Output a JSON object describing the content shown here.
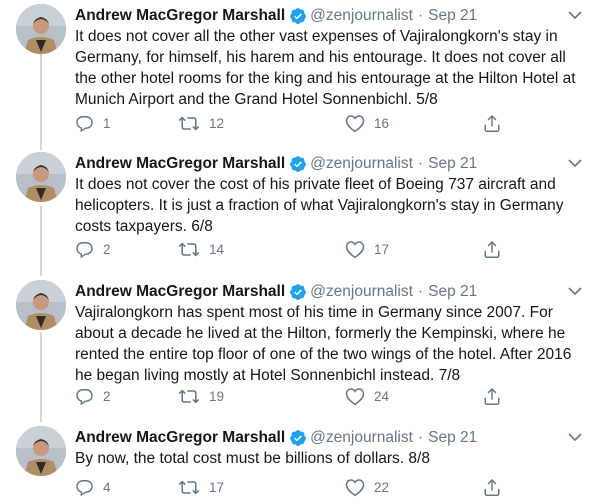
{
  "tweets": [
    {
      "name": "Andrew MacGregor Marshall",
      "handle": "@zenjournalist",
      "separator": "·",
      "date": "Sep 21",
      "lines": [
        "It does not cover all the other vast expenses of Vajiralongkorn's stay in",
        "Germany, for himself, his harem and his entourage. It does not cover all",
        "the other hotel rooms for the king and his entourage at the Hilton Hotel at",
        "Munich Airport and the Grand Hotel Sonnenbichl. 5/8"
      ],
      "replies": "1",
      "retweets": "12",
      "likes": "16"
    },
    {
      "name": "Andrew MacGregor Marshall",
      "handle": "@zenjournalist",
      "separator": "·",
      "date": "Sep 21",
      "lines": [
        "It does not cover the cost of his private fleet of Boeing 737 aircraft and",
        "helicopters. It is just a fraction of what Vajiralongkorn's stay in Germany",
        "costs taxpayers. 6/8"
      ],
      "replies": "2",
      "retweets": "14",
      "likes": "17"
    },
    {
      "name": "Andrew MacGregor Marshall",
      "handle": "@zenjournalist",
      "separator": "·",
      "date": "Sep 21",
      "lines": [
        "Vajiralongkorn has spent most of his time in Germany since 2007. For",
        "about a decade he lived at the Hilton, formerly the Kempinski, where he",
        "rented the entire top floor of one of the two wings of the hotel. After 2016",
        "he began living mostly at Hotel Sonnenbichl instead. 7/8"
      ],
      "replies": "2",
      "retweets": "19",
      "likes": "24"
    },
    {
      "name": "Andrew MacGregor Marshall",
      "handle": "@zenjournalist",
      "separator": "·",
      "date": "Sep 21",
      "lines": [
        "By now, the total cost must be billions of dollars. 8/8"
      ],
      "replies": "4",
      "retweets": "17",
      "likes": "22"
    }
  ],
  "icons": {
    "reply": "reply-icon",
    "retweet": "retweet-icon",
    "like": "like-icon",
    "share": "share-icon",
    "verified": "verified-badge-icon",
    "more": "chevron-down-icon"
  },
  "colors": {
    "text": "#14171a",
    "secondary": "#657786",
    "verified": "#1da1f2",
    "thread_line": "#cfd9de"
  }
}
